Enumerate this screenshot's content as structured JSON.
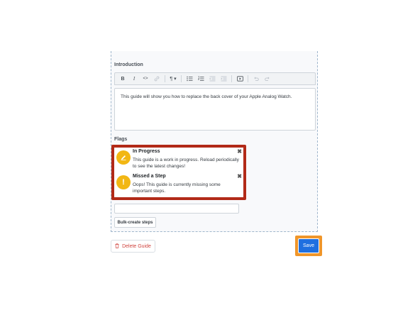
{
  "introduction": {
    "label": "Introduction",
    "text": "This guide will show you how to replace the back cover of your Apple Analog Watch."
  },
  "toolbar": {
    "bold": "B",
    "italic": "I",
    "code": "<>",
    "paragraph": "¶ ▾"
  },
  "flags": {
    "label": "Flags",
    "items": [
      {
        "title": "In Progress",
        "description": "This guide is a work in progress. Reload periodically to see the latest changes!",
        "icon": "pencil-icon",
        "close": "✖"
      },
      {
        "title": "Missed a Step",
        "description": "Oops! This guide is currently missing some important steps.",
        "icon": "exclamation-icon",
        "close": "✖"
      }
    ]
  },
  "bulk_create_label": "Bulk-create steps",
  "delete_label": "Delete Guide",
  "save_label": "Save",
  "colors": {
    "highlight_red": "#b22a18",
    "highlight_orange": "#f0962a",
    "save_blue": "#1f6fe0",
    "flag_yellow": "#f2b714",
    "delete_red": "#d0443f"
  }
}
